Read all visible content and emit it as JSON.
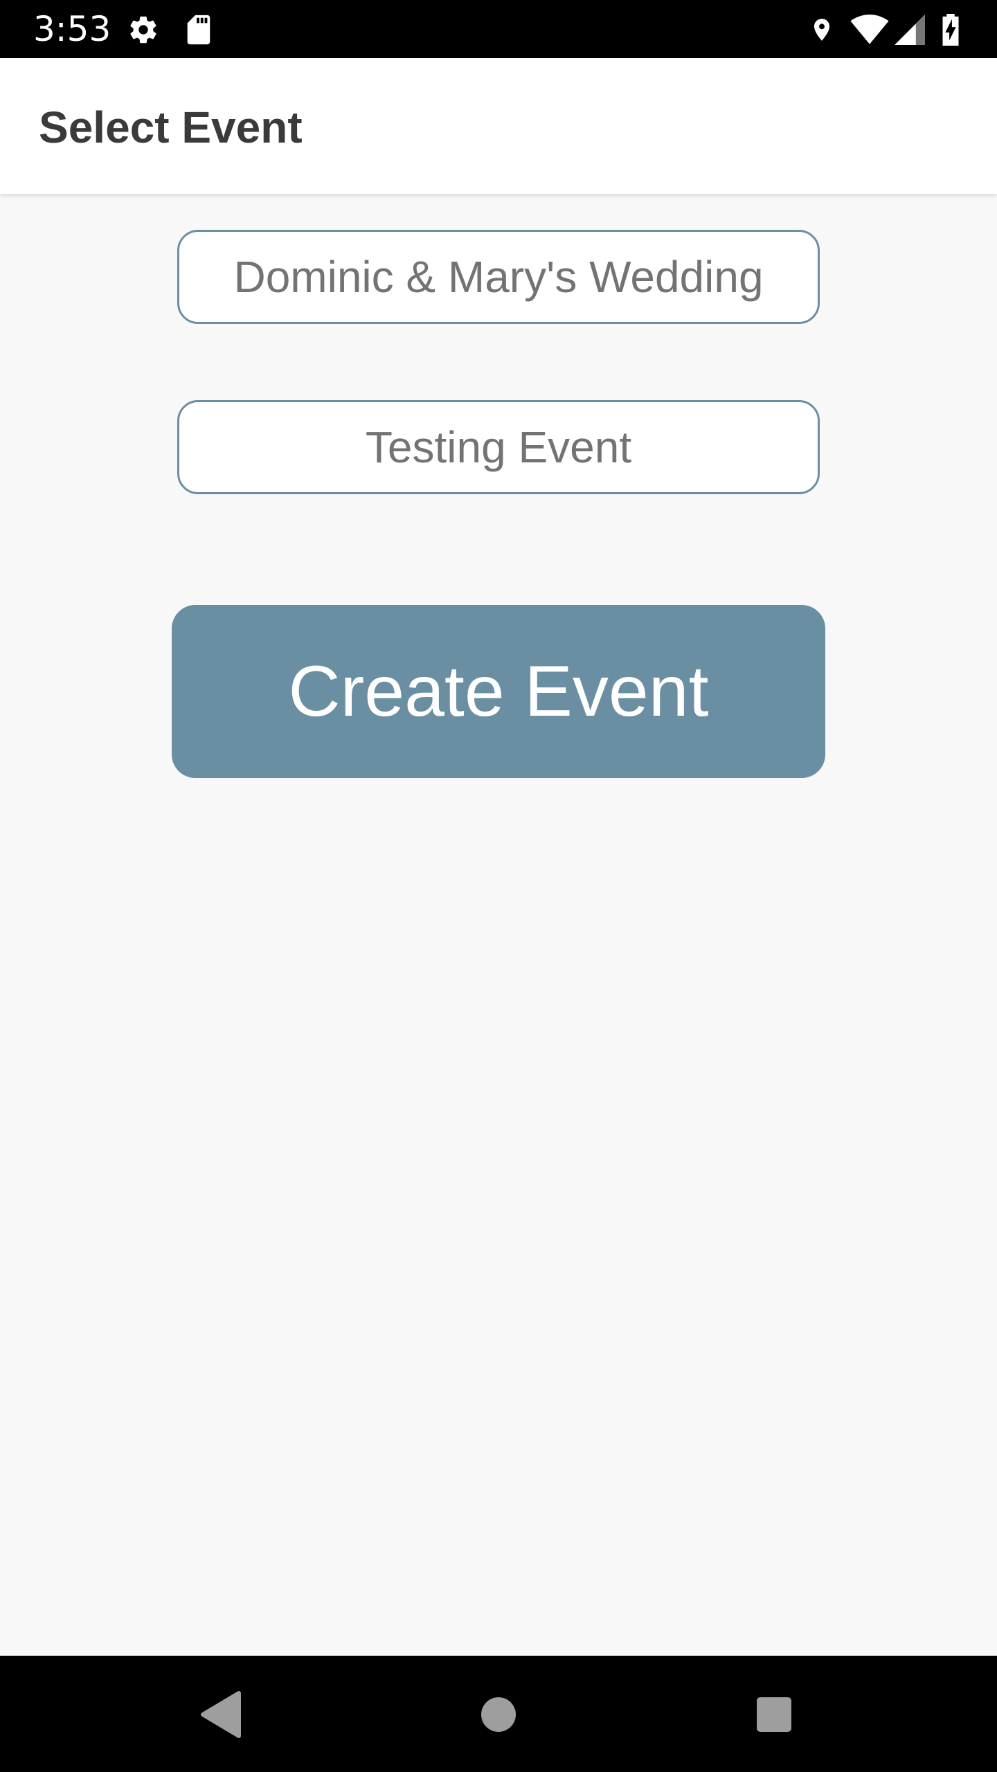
{
  "status_bar": {
    "time": "3:53",
    "icons": [
      "settings-icon",
      "sd-card-icon",
      "location-icon",
      "wifi-icon",
      "cell-signal-icon",
      "battery-charging-icon"
    ]
  },
  "app_bar": {
    "title": "Select Event"
  },
  "events": [
    {
      "label": "Dominic & Mary's Wedding"
    },
    {
      "label": "Testing Event"
    }
  ],
  "create_button": {
    "label": "Create Event"
  },
  "nav_bar": {
    "icons": [
      "back-icon",
      "home-icon",
      "recents-icon"
    ]
  },
  "colors": {
    "accent": "#6a8fa3",
    "background": "#f8f8f9",
    "button_text": "#737373"
  }
}
